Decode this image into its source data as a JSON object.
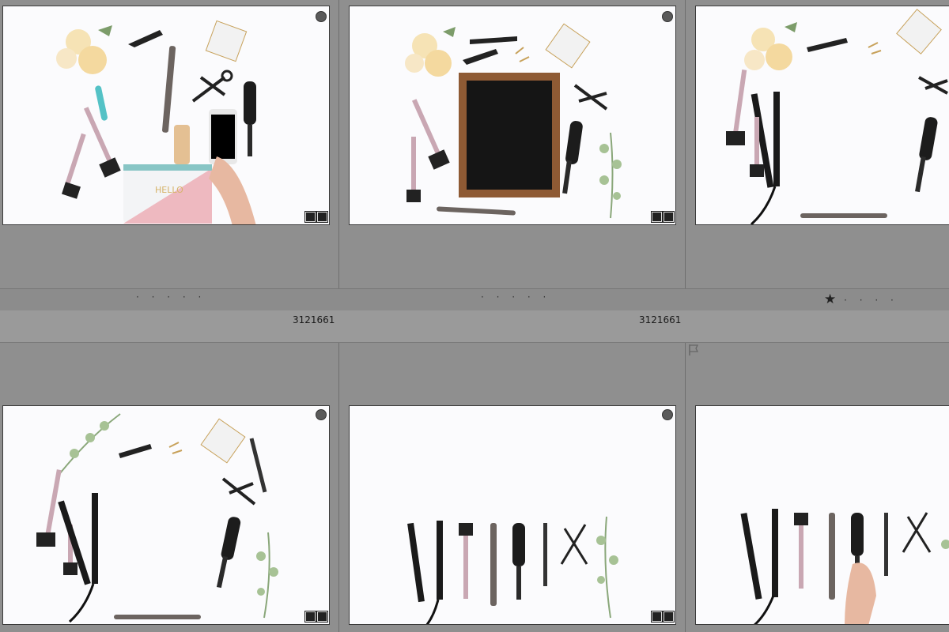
{
  "grid": {
    "cells": [
      {
        "id": "photo-1",
        "rating": "· · · · ·",
        "starred": false
      },
      {
        "id": "photo-2",
        "rating": "· · · · ·",
        "starred": false
      },
      {
        "id": "photo-3",
        "rating": "· · · ·",
        "starred": true
      }
    ],
    "row2_headers": [
      {
        "filename": "3121661"
      },
      {
        "filename": "3121661"
      }
    ]
  },
  "icons": {
    "badge": "circle-badge-icon",
    "edit": "develop-adjustment-icon",
    "star": "star-icon",
    "flag": "flag-icon"
  },
  "colors": {
    "background": "#8f8f8f",
    "thumb_bg": "#fbfbfd"
  }
}
